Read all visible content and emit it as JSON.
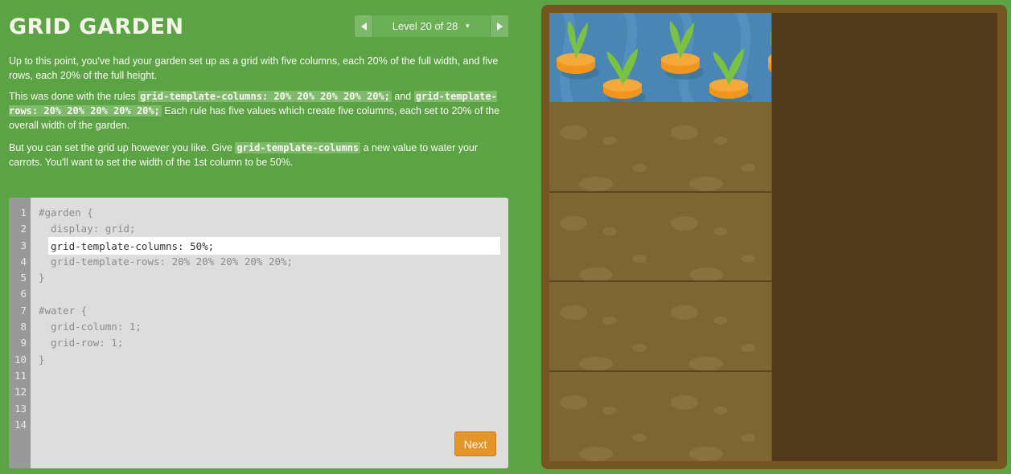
{
  "app": {
    "title": "GRID GARDEN"
  },
  "level_nav": {
    "label": "Level 20 of 28",
    "prev_icon": "triangle-left-icon",
    "next_icon": "triangle-right-icon",
    "caret_icon": "caret-down-icon"
  },
  "instructions": {
    "p1": "Up to this point, you've had your garden set up as a grid with five columns, each 20% of the full width, and five rows, each 20% of the full height.",
    "p2_prefix": "This was done with the rules ",
    "p2_code1": "grid-template-columns: 20% 20% 20% 20% 20%;",
    "p2_mid": " and ",
    "p2_code2": "grid-template-rows: 20% 20% 20% 20% 20%;",
    "p2_suffix": " Each rule has five values which create five columns, each set to 20% of the overall width of the garden.",
    "p3_prefix": "But you can set the grid up however you like. Give ",
    "p3_code": "grid-template-columns",
    "p3_suffix": " a new value to water your carrots. You'll want to set the width of the 1st column to be 50%."
  },
  "editor": {
    "line_numbers": [
      "1",
      "2",
      "3",
      "4",
      "5",
      "6",
      "7",
      "8",
      "9",
      "10",
      "11",
      "12",
      "13",
      "14"
    ],
    "lines": [
      "#garden {",
      "  display: grid;",
      "",
      "  grid-template-rows: 20% 20% 20% 20% 20%;",
      "}",
      "",
      "#water {",
      "  grid-column: 1;",
      "  grid-row: 1;",
      "}",
      "",
      "",
      "",
      ""
    ],
    "input_value": "grid-template-columns: 50%;",
    "next_label": "Next"
  },
  "garden": {
    "colors": {
      "frame": "#755622",
      "soil": "#7d6633",
      "water": "#4a86b4",
      "empty": "#523a1d",
      "carrot": "#f0961d",
      "leaf": "#7cc242"
    }
  }
}
